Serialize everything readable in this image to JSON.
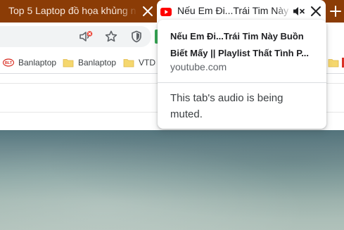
{
  "tabs": [
    {
      "title": "Top 5 Laptop đồ họa khủng n",
      "active": false
    },
    {
      "title": "Nếu Em Đi...Trái Tim Này Bu",
      "active": true,
      "audio_state": "muted"
    }
  ],
  "bookmarks": [
    {
      "label": "Banlaptop",
      "icon": "favicon"
    },
    {
      "label": "Banlaptop",
      "icon": "folder-icon"
    },
    {
      "label": "VTD",
      "icon": "folder-icon"
    }
  ],
  "hovercard": {
    "title": "Nếu Em Đi...Trái Tim Này Buồn Biết Mấy || Playlist Thất Tình P...",
    "domain": "youtube.com",
    "alert": "This tab's audio is being muted."
  },
  "colors": {
    "tabstrip": "#8b3c06",
    "youtube_red": "#ff0000",
    "folder": "#f5d76e"
  }
}
